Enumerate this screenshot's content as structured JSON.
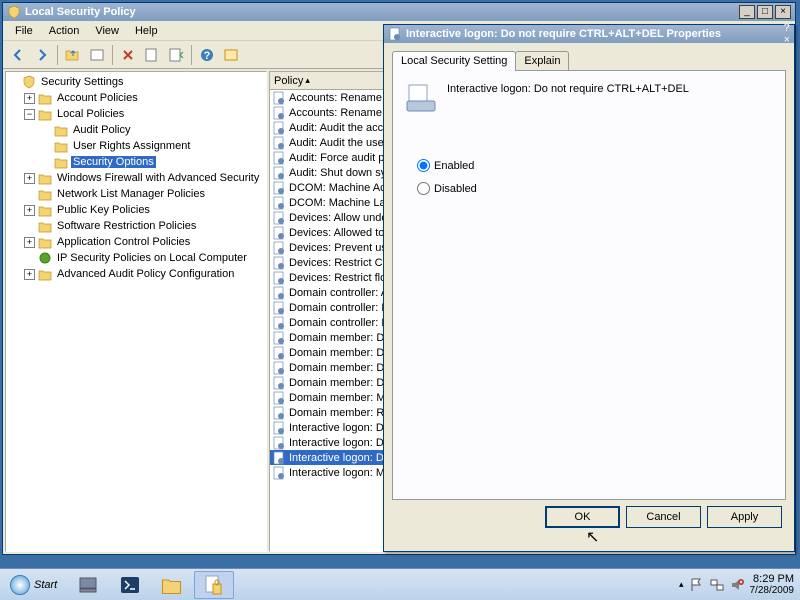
{
  "window": {
    "title": "Local Security Policy"
  },
  "menu": {
    "file": "File",
    "action": "Action",
    "view": "View",
    "help": "Help"
  },
  "tree": {
    "root": "Security Settings",
    "account": "Account Policies",
    "local": "Local Policies",
    "audit": "Audit Policy",
    "user_rights": "User Rights Assignment",
    "security_options": "Security Options",
    "firewall": "Windows Firewall with Advanced Security",
    "network_list": "Network List Manager Policies",
    "pubkey": "Public Key Policies",
    "software_restrict": "Software Restriction Policies",
    "app_control": "Application Control Policies",
    "ipsec": "IP Security Policies on Local Computer",
    "adv_audit": "Advanced Audit Policy Configuration"
  },
  "list": {
    "header": "Policy",
    "items": {
      "i0": "Accounts: Rename administrator account",
      "i1": "Accounts: Rename guest account",
      "i2": "Audit: Audit the access of global system objects",
      "i3": "Audit: Audit the use of Backup and Restore privilege",
      "i4": "Audit: Force audit policy subcategory settings",
      "i5": "Audit: Shut down system immediately if unable to log",
      "i6": "DCOM: Machine Access Restrictions",
      "i7": "DCOM: Machine Launch Restrictions",
      "i8": "Devices: Allow undock without having to log on",
      "i9": "Devices: Allowed to format and eject removable media",
      "i10": "Devices: Prevent users from installing printer drivers",
      "i11": "Devices: Restrict CD-ROM access",
      "i12": "Devices: Restrict floppy access",
      "i13": "Domain controller: Allow server operators",
      "i14": "Domain controller: LDAP server signing",
      "i15": "Domain controller: Refuse machine account",
      "i16": "Domain member: Digitally encrypt or sign",
      "i17": "Domain member: Digitally encrypt secure channel",
      "i18": "Domain member: Digitally sign secure channel",
      "i19": "Domain member: Disable machine account",
      "i20": "Domain member: Maximum machine account",
      "i21": "Domain member: Require strong session key",
      "i22": "Interactive logon: Display user information",
      "i23": "Interactive logon: Do not display last user name",
      "i24": "Interactive logon: Do not require CTRL+ALT+DEL",
      "i25": "Interactive logon: Message text for users attempting to log on"
    }
  },
  "dialog": {
    "title": "Interactive logon: Do not require CTRL+ALT+DEL Properties",
    "tab_local": "Local Security Setting",
    "tab_explain": "Explain",
    "heading": "Interactive logon: Do not require CTRL+ALT+DEL",
    "enabled": "Enabled",
    "disabled": "Disabled",
    "ok": "OK",
    "cancel": "Cancel",
    "apply": "Apply"
  },
  "taskbar": {
    "start": "Start",
    "time": "8:29 PM",
    "date": "7/28/2009"
  }
}
